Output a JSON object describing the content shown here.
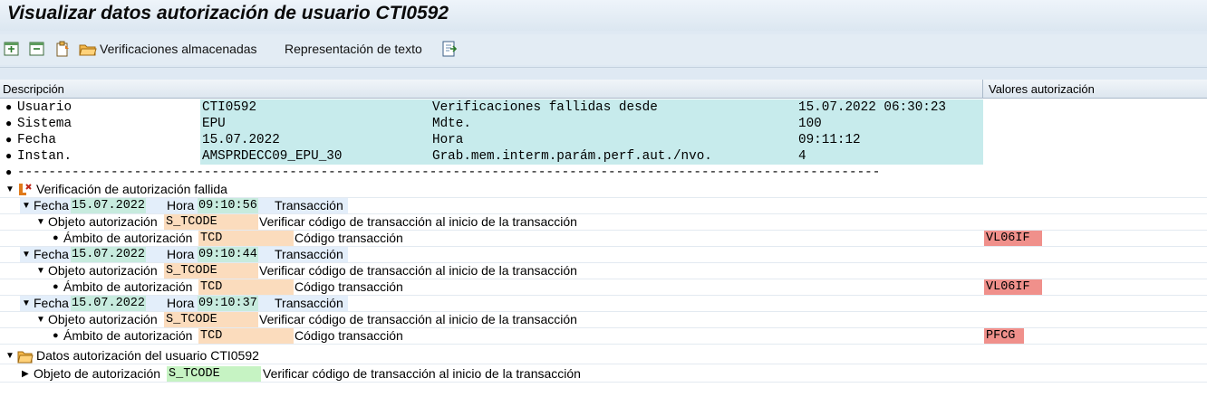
{
  "window": {
    "title": "Visualizar datos autorización de usuario CTI0592"
  },
  "toolbar": {
    "icons": [
      "expand-subtree-icon",
      "collapse-subtree-icon",
      "choose-details-icon",
      "open-folder-icon",
      "export-icon"
    ],
    "stored_checks_label": "Verificaciones almacenadas",
    "text_representation_label": "Representación de texto"
  },
  "grid": {
    "columns": {
      "description": "Descripción",
      "auth_values": "Valores autorización"
    },
    "header_info": [
      {
        "label": "Usuario",
        "value": "CTI0592",
        "label2": "Verificaciones fallidas desde",
        "value2": "15.07.2022 06:30:23"
      },
      {
        "label": "Sistema",
        "value": "EPU",
        "label2": "Mdte.",
        "value2": "100"
      },
      {
        "label": "Fecha",
        "value": "15.07.2022",
        "label2": "Hora",
        "value2": "09:11:12"
      },
      {
        "label": "Instan.",
        "value": "AMSPRDECC09_EPU_30",
        "label2": "Grab.mem.interm.parám.perf.aut./nvo.",
        "value2": "4"
      }
    ],
    "separator": "------------------------------------------------------------------------------------------------------------------------",
    "failed_section": {
      "title": "Verificación de autorización fallida",
      "entries": [
        {
          "date_label": "Fecha",
          "date": "15.07.2022",
          "time_label": "Hora",
          "time": "09:10:56",
          "kind": "Transacción",
          "object_label": "Objeto autorización",
          "object": "S_TCODE",
          "object_desc": "Verificar código de transacción al inicio de la transacción",
          "field_label": "Ámbito de autorización",
          "field": "TCD",
          "field_desc": "Código transacción",
          "value": "VL06IF"
        },
        {
          "date_label": "Fecha",
          "date": "15.07.2022",
          "time_label": "Hora",
          "time": "09:10:44",
          "kind": "Transacción",
          "object_label": "Objeto autorización",
          "object": "S_TCODE",
          "object_desc": "Verificar código de transacción al inicio de la transacción",
          "field_label": "Ámbito de autorización",
          "field": "TCD",
          "field_desc": "Código transacción",
          "value": "VL06IF"
        },
        {
          "date_label": "Fecha",
          "date": "15.07.2022",
          "time_label": "Hora",
          "time": "09:10:37",
          "kind": "Transacción",
          "object_label": "Objeto autorización",
          "object": "S_TCODE",
          "object_desc": "Verificar código de transacción al inicio de la transacción",
          "field_label": "Ámbito de autorización",
          "field": "TCD",
          "field_desc": "Código transacción",
          "value": "PFCG"
        }
      ]
    },
    "user_auth_section": {
      "title": "Datos autorización del usuario CTI0592",
      "object_label": "Objeto de autorización",
      "object": "S_TCODE",
      "object_desc": "Verificar código de transacción al inicio de la transacción"
    }
  },
  "colors": {
    "background": "#dfe9f3",
    "info_highlight": "#c7ebec",
    "date_highlight": "#c7ebde",
    "object_highlight": "#fbdcbd",
    "failed_value": "#f0908b",
    "user_object_highlight": "#c6f3c3"
  }
}
